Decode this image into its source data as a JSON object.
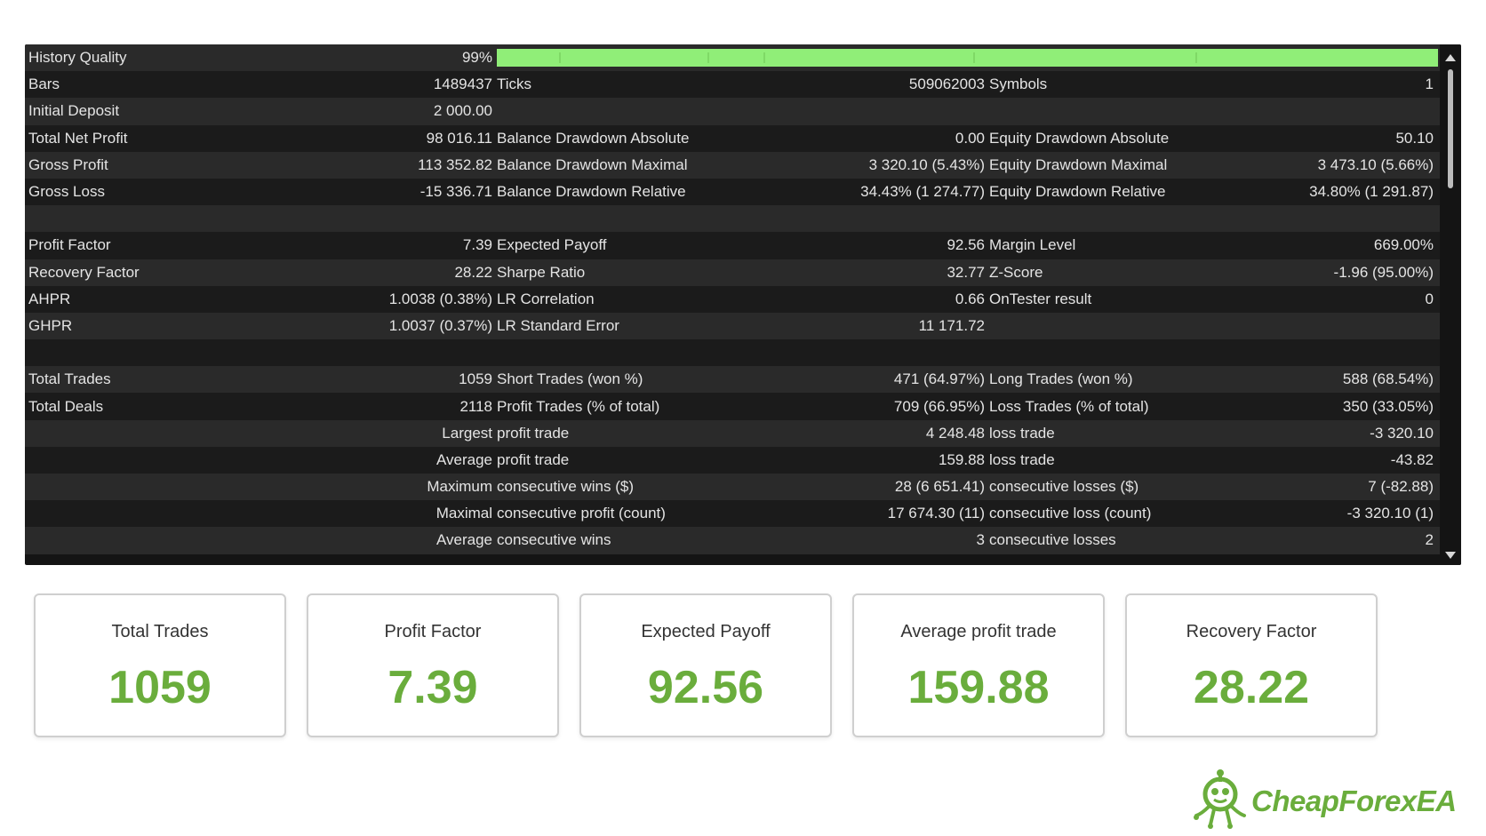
{
  "report": {
    "history_quality": {
      "label": "History Quality",
      "value": "99%",
      "bar_fraction": 0.99
    },
    "rows": [
      {
        "c1": [
          "Bars",
          "1489437"
        ],
        "c2": [
          "Ticks",
          "509062003"
        ],
        "c3": [
          "Symbols",
          "1"
        ]
      },
      {
        "c1": [
          "Initial Deposit",
          "2 000.00"
        ],
        "c2": [
          "",
          ""
        ],
        "c3": [
          "",
          ""
        ]
      },
      {
        "c1": [
          "Total Net Profit",
          "98 016.11"
        ],
        "c2": [
          "Balance Drawdown Absolute",
          "0.00"
        ],
        "c3": [
          "Equity Drawdown Absolute",
          "50.10"
        ]
      },
      {
        "c1": [
          "Gross Profit",
          "113 352.82"
        ],
        "c2": [
          "Balance Drawdown Maximal",
          "3 320.10 (5.43%)"
        ],
        "c3": [
          "Equity Drawdown Maximal",
          "3 473.10 (5.66%)"
        ]
      },
      {
        "c1": [
          "Gross Loss",
          "-15 336.71"
        ],
        "c2": [
          "Balance Drawdown Relative",
          "34.43% (1 274.77)"
        ],
        "c3": [
          "Equity Drawdown Relative",
          "34.80% (1 291.87)"
        ]
      },
      {
        "c1": [
          "",
          ""
        ],
        "c2": [
          "",
          ""
        ],
        "c3": [
          "",
          ""
        ]
      },
      {
        "c1": [
          "Profit Factor",
          "7.39"
        ],
        "c2": [
          "Expected Payoff",
          "92.56"
        ],
        "c3": [
          "Margin Level",
          "669.00%"
        ]
      },
      {
        "c1": [
          "Recovery Factor",
          "28.22"
        ],
        "c2": [
          "Sharpe Ratio",
          "32.77"
        ],
        "c3": [
          "Z-Score",
          "-1.96 (95.00%)"
        ]
      },
      {
        "c1": [
          "AHPR",
          "1.0038 (0.38%)"
        ],
        "c2": [
          "LR Correlation",
          "0.66"
        ],
        "c3": [
          "OnTester result",
          "0"
        ]
      },
      {
        "c1": [
          "GHPR",
          "1.0037 (0.37%)"
        ],
        "c2": [
          "LR Standard Error",
          "11 171.72"
        ],
        "c3": [
          "",
          ""
        ]
      },
      {
        "c1": [
          "",
          ""
        ],
        "c2": [
          "",
          ""
        ],
        "c3": [
          "",
          ""
        ]
      },
      {
        "c1": [
          "Total Trades",
          "1059"
        ],
        "c2": [
          "Short Trades (won %)",
          "471 (64.97%)"
        ],
        "c3": [
          "Long Trades (won %)",
          "588 (68.54%)"
        ]
      },
      {
        "c1": [
          "Total Deals",
          "2118"
        ],
        "c2": [
          "Profit Trades (% of total)",
          "709 (66.95%)"
        ],
        "c3": [
          "Loss Trades (% of total)",
          "350 (33.05%)"
        ]
      },
      {
        "c1": [
          "",
          "Largest"
        ],
        "c2": [
          "profit trade",
          "4 248.48"
        ],
        "c3": [
          "loss trade",
          "-3 320.10"
        ]
      },
      {
        "c1": [
          "",
          "Average"
        ],
        "c2": [
          "profit trade",
          "159.88"
        ],
        "c3": [
          "loss trade",
          "-43.82"
        ]
      },
      {
        "c1": [
          "",
          "Maximum"
        ],
        "c2": [
          "consecutive wins ($)",
          "28 (6 651.41)"
        ],
        "c3": [
          "consecutive losses ($)",
          "7 (-82.88)"
        ]
      },
      {
        "c1": [
          "",
          "Maximal"
        ],
        "c2": [
          "consecutive profit (count)",
          "17 674.30 (11)"
        ],
        "c3": [
          "consecutive loss (count)",
          "-3 320.10 (1)"
        ]
      },
      {
        "c1": [
          "",
          "Average"
        ],
        "c2": [
          "consecutive wins",
          "3"
        ],
        "c3": [
          "consecutive losses",
          "2"
        ]
      }
    ]
  },
  "cards": [
    {
      "label": "Total Trades",
      "value": "1059"
    },
    {
      "label": "Profit Factor",
      "value": "7.39"
    },
    {
      "label": "Expected Payoff",
      "value": "92.56"
    },
    {
      "label": "Average profit trade",
      "value": "159.88"
    },
    {
      "label": "Recovery Factor",
      "value": "28.22"
    }
  ],
  "logo": {
    "text": "CheapForexEA",
    "icon": "robot-mascot-icon"
  },
  "colors": {
    "accent_green": "#6aad3c",
    "quality_bar": "#90ee78",
    "row_dark": "#1b1b1b",
    "row_light": "#2a2a2a",
    "text_light": "#e4e4e4"
  }
}
